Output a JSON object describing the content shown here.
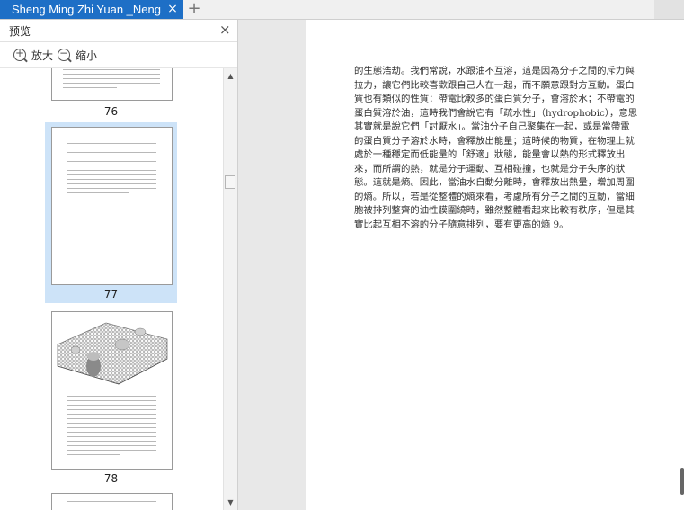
{
  "tab": {
    "title": "Sheng Ming Zhi Yuan _Neng Liang",
    "close_glyph": "×",
    "new_tab_glyph": "+"
  },
  "panel": {
    "title": "预览",
    "close_glyph": "×",
    "zoom_in_label": "放大",
    "zoom_out_label": "缩小",
    "pages": [
      {
        "number": "76",
        "selected": false
      },
      {
        "number": "77",
        "selected": true
      },
      {
        "number": "78",
        "selected": false
      }
    ]
  },
  "scrollbar": {
    "up_glyph": "▲",
    "down_glyph": "▼"
  },
  "document": {
    "text": "的生態浩劫。我們常說，水跟油不互溶，這是因為分子之間的斥力與\n拉力，讓它們比較喜歡跟自己人在一起，而不願意跟對方互動。蛋白\n質也有類似的性質：帶電比較多的蛋白質分子，會溶於水；不帶電的\n蛋白質溶於油，這時我們會說它有「疏水性」（hydrophobic），意思\n其實就是說它們「討厭水」。當油分子自己聚集在一起，或是當帶電\n的蛋白質分子溶於水時，會釋放出能量；這時候的物質，在物理上就\n處於一種穩定而低能量的「舒適」狀態，能量會以熱的形式釋放出\n來，而所謂的熱，就是分子運動、互相碰撞，也就是分子失序的狀\n態。這就是熵。因此，當油水自動分離時，會釋放出熱量，增加周圍\n的熵。所以，若是從整體的熵來看，考慮所有分子之間的互動，當細\n胞被排列整齊的油性膜圍繞時，雖然整體看起來比較有秩序，但是其\n實比起互相不溶的分子隨意排列，要有更高的熵 9。"
  }
}
